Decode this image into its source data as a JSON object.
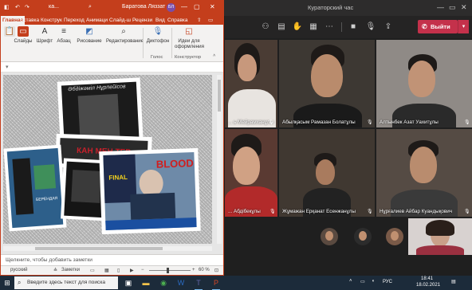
{
  "teams": {
    "title": "Кураторский час",
    "leave_label": "Выйти",
    "participants": [
      {
        "name": "... ь Мейрамханұлы"
      },
      {
        "name": "Абылқасым Рамазан Болатұлы"
      },
      {
        "name": "Алтынбек Азат Уахитұлы"
      },
      {
        "name": "... Абдібекұлы"
      },
      {
        "name": "Жұмажан Ерқанат Есенжанұлы"
      },
      {
        "name": "Нұрғалиев Айбар Куандықович"
      }
    ]
  },
  "ppt": {
    "app_short": "ка...",
    "user_name": "Баратова Ляззат",
    "avatar_initials": "БЛ",
    "tabs": [
      "Главная",
      "Вставка",
      "Конструк",
      "Переход",
      "Анимаци",
      "Слайд-ш",
      "Рецензи",
      "Вид",
      "Справка"
    ],
    "ribbon": {
      "slides": "Слайды",
      "font": "Шрифт",
      "paragraph": "Абзац",
      "drawing": "Рисование",
      "editing": "Редактирование",
      "dictate": "Диктофон",
      "design_ideas": "Идеи для оформления",
      "group_voice": "Голос",
      "group_designer": "Конструктор"
    },
    "slide": {
      "photo_caption_top": "Әбдіжәміл Нұрпейісов",
      "banner_text": "КАН МЕН ТЕР",
      "book_label": "БЕРЕНДАЯ",
      "blood_label": "BLOOD",
      "final_label": "FINAL"
    },
    "notes_placeholder": "Щелкните, чтобы добавить заметки",
    "status": {
      "language": "русский",
      "notes_btn": "Заметки",
      "zoom": "60 %"
    }
  },
  "taskbar": {
    "search_placeholder": "Введите здесь текст для поиска",
    "lang": "РУС",
    "time": "18:41",
    "date": "18.02.2021"
  }
}
